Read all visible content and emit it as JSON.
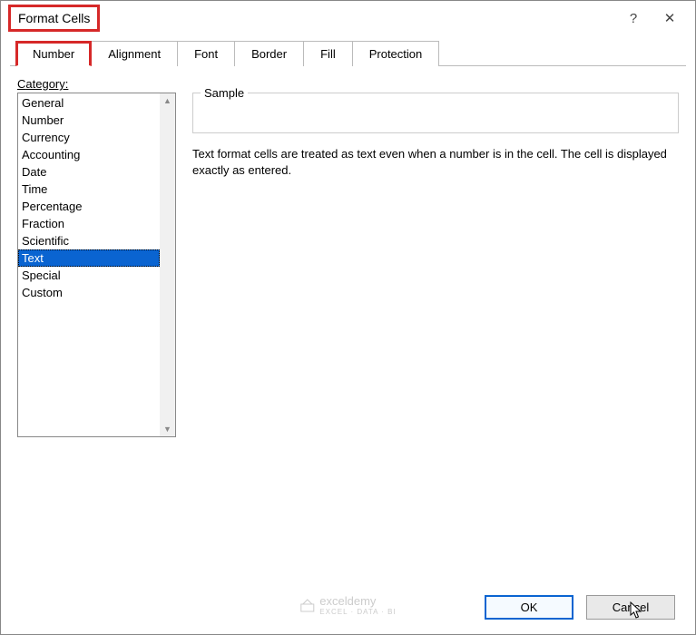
{
  "window": {
    "title": "Format Cells",
    "help_icon": "?",
    "close_icon": "✕"
  },
  "tabs": [
    {
      "label": "Number",
      "active": true
    },
    {
      "label": "Alignment",
      "active": false
    },
    {
      "label": "Font",
      "active": false
    },
    {
      "label": "Border",
      "active": false
    },
    {
      "label": "Fill",
      "active": false
    },
    {
      "label": "Protection",
      "active": false
    }
  ],
  "category": {
    "label_prefix": "C",
    "label_rest": "ategory:",
    "items": [
      "General",
      "Number",
      "Currency",
      "Accounting",
      "Date",
      "Time",
      "Percentage",
      "Fraction",
      "Scientific",
      "Text",
      "Special",
      "Custom"
    ],
    "selected_index": 9
  },
  "sample": {
    "legend": "Sample",
    "value": ""
  },
  "description": "Text format cells are treated as text even when a number is in the cell. The cell is displayed exactly as entered.",
  "buttons": {
    "ok": "OK",
    "cancel": "Cancel"
  },
  "watermark": {
    "brand": "exceldemy",
    "sub": "EXCEL · DATA · BI"
  }
}
